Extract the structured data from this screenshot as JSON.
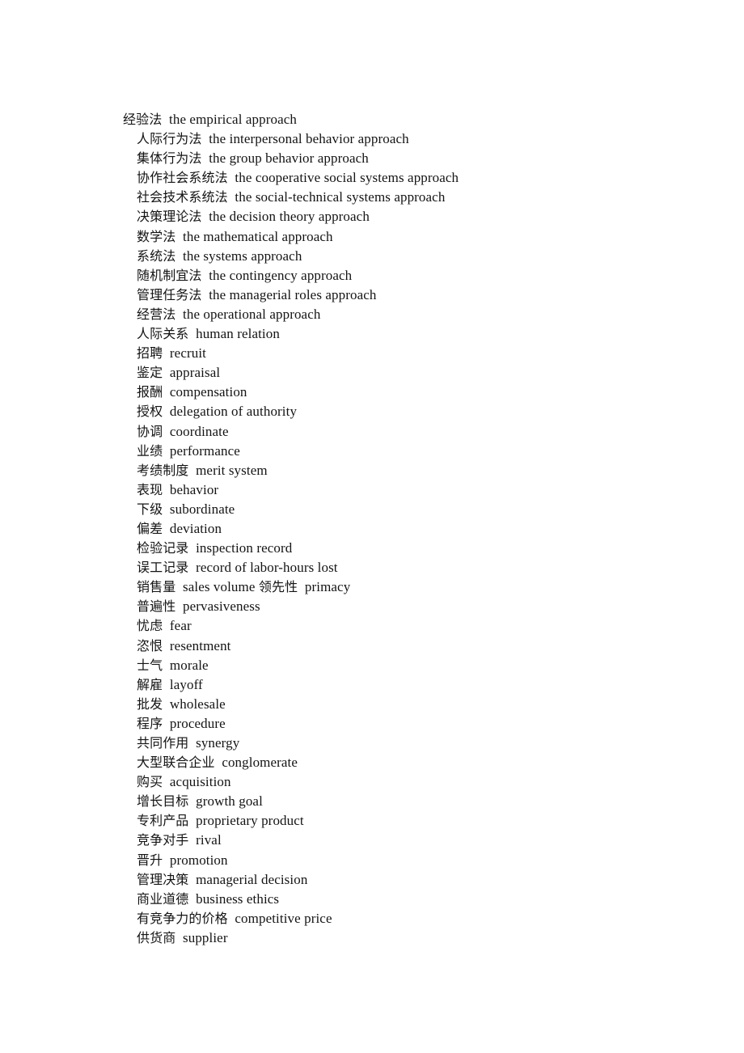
{
  "document": {
    "background_color": "#ffffff",
    "text_color": "#141414",
    "separator": "  "
  },
  "glossary": {
    "entries": [
      {
        "term": "经验法",
        "gloss": "the empirical approach",
        "lead": true
      },
      {
        "term": "人际行为法",
        "gloss": "the interpersonal behavior approach"
      },
      {
        "term": "集体行为法",
        "gloss": "the group behavior approach"
      },
      {
        "term": "协作社会系统法",
        "gloss": "the cooperative social systems approach"
      },
      {
        "term": "社会技术系统法",
        "gloss": "the social-technical systems approach"
      },
      {
        "term": "决策理论法",
        "gloss": "the decision theory approach"
      },
      {
        "term": "数学法",
        "gloss": "the mathematical approach"
      },
      {
        "term": "系统法",
        "gloss": "the systems approach"
      },
      {
        "term": "随机制宜法",
        "gloss": "the contingency approach"
      },
      {
        "term": "管理任务法",
        "gloss": "the managerial roles approach"
      },
      {
        "term": "经营法",
        "gloss": "the operational approach"
      },
      {
        "term": "人际关系",
        "gloss": "human relation"
      },
      {
        "term": "招聘",
        "gloss": "recruit"
      },
      {
        "term": "鉴定",
        "gloss": "appraisal"
      },
      {
        "term": "报酬",
        "gloss": "compensation"
      },
      {
        "term": "授权",
        "gloss": "delegation of authority"
      },
      {
        "term": "协调",
        "gloss": "coordinate"
      },
      {
        "term": "业绩",
        "gloss": "performance"
      },
      {
        "term": "考绩制度",
        "gloss": "merit system"
      },
      {
        "term": "表现",
        "gloss": "behavior"
      },
      {
        "term": "下级",
        "gloss": "subordinate"
      },
      {
        "term": "偏差",
        "gloss": "deviation"
      },
      {
        "term": "检验记录",
        "gloss": "inspection record"
      },
      {
        "term": "误工记录",
        "gloss": "record of labor-hours lost"
      },
      {
        "term": "销售量",
        "gloss": "sales volume",
        "term2": "领先性",
        "gloss2": "primacy"
      },
      {
        "term": "普遍性",
        "gloss": "pervasiveness"
      },
      {
        "term": "忧虑",
        "gloss": "fear"
      },
      {
        "term": "恣恨",
        "gloss": "resentment"
      },
      {
        "term": "士气",
        "gloss": "morale"
      },
      {
        "term": "解雇",
        "gloss": "layoff"
      },
      {
        "term": "批发",
        "gloss": "wholesale"
      },
      {
        "term": "程序",
        "gloss": "procedure"
      },
      {
        "term": "共同作用",
        "gloss": "synergy"
      },
      {
        "term": "大型联合企业",
        "gloss": "conglomerate"
      },
      {
        "term": "购买",
        "gloss": "acquisition"
      },
      {
        "term": "增长目标",
        "gloss": "growth goal"
      },
      {
        "term": "专利产品",
        "gloss": "proprietary product"
      },
      {
        "term": "竞争对手",
        "gloss": "rival"
      },
      {
        "term": "晋升",
        "gloss": "promotion"
      },
      {
        "term": "管理决策",
        "gloss": "managerial decision"
      },
      {
        "term": "商业道德",
        "gloss": "business ethics"
      },
      {
        "term": "有竞争力的价格",
        "gloss": "competitive price"
      },
      {
        "term": "供货商",
        "gloss": "supplier"
      }
    ]
  }
}
